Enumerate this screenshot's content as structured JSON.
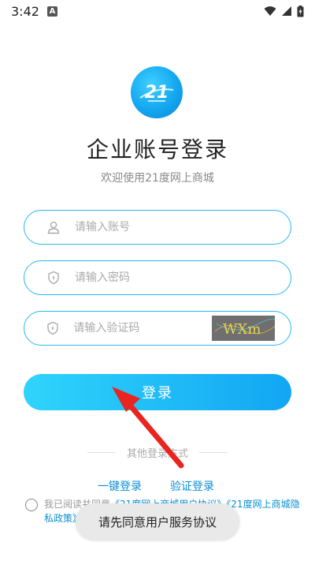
{
  "status_bar": {
    "time": "3:42",
    "icons": [
      "notification-a-icon",
      "wifi-icon",
      "signal-icon",
      "battery-charging-icon"
    ]
  },
  "logo": {
    "text": "21",
    "icon": "logo-21-icon"
  },
  "header": {
    "title": "企业账号登录",
    "subtitle": "欢迎使用21度网上商城"
  },
  "form": {
    "account_placeholder": "请输入账号",
    "password_placeholder": "请输入密码",
    "captcha_placeholder": "请输入验证码",
    "captcha_text": "WXm",
    "login_label": "登录"
  },
  "other_login": {
    "label": "其他登录方式",
    "one_click": "一键登录",
    "verify": "验证登录"
  },
  "agreement": {
    "prefix": "我已阅读并同意",
    "link1": "《21度网上商城用户协议》",
    "link2": "《21度网上商城隐私政策》"
  },
  "toast": {
    "text": "请先同意用户服务协议"
  },
  "colors": {
    "accent": "#29b6f6",
    "button_start": "#2fd4fb",
    "button_end": "#12a6f3",
    "link": "#0b8fd6",
    "arrow": "#e8251f"
  }
}
